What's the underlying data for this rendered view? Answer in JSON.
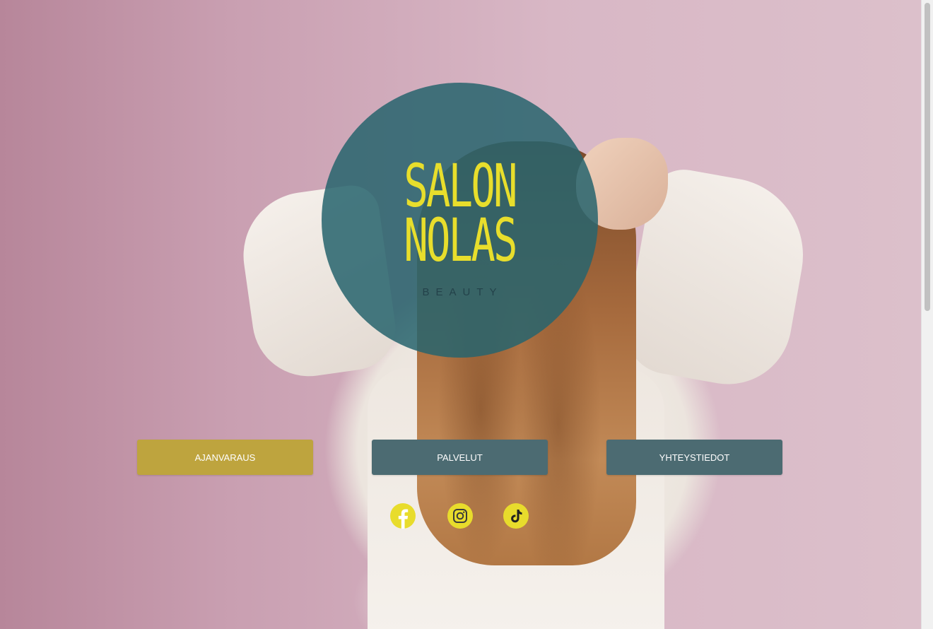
{
  "logo": {
    "line1": "SALON",
    "line2": "NOLAS",
    "tagline": "BEAUTY"
  },
  "nav": {
    "buttons": [
      {
        "label": "AJANVARAUS"
      },
      {
        "label": "PALVELUT"
      },
      {
        "label": "YHTEYSTIEDOT"
      }
    ]
  },
  "social": {
    "icons": [
      "facebook-icon",
      "instagram-icon",
      "tiktok-icon"
    ]
  },
  "colors": {
    "logo_circle": "#28646e",
    "logo_text": "#e8de2c",
    "primary_button": "#bea43e",
    "secondary_button": "#4c6b72",
    "social_icon_bg": "#e8dc2c"
  }
}
